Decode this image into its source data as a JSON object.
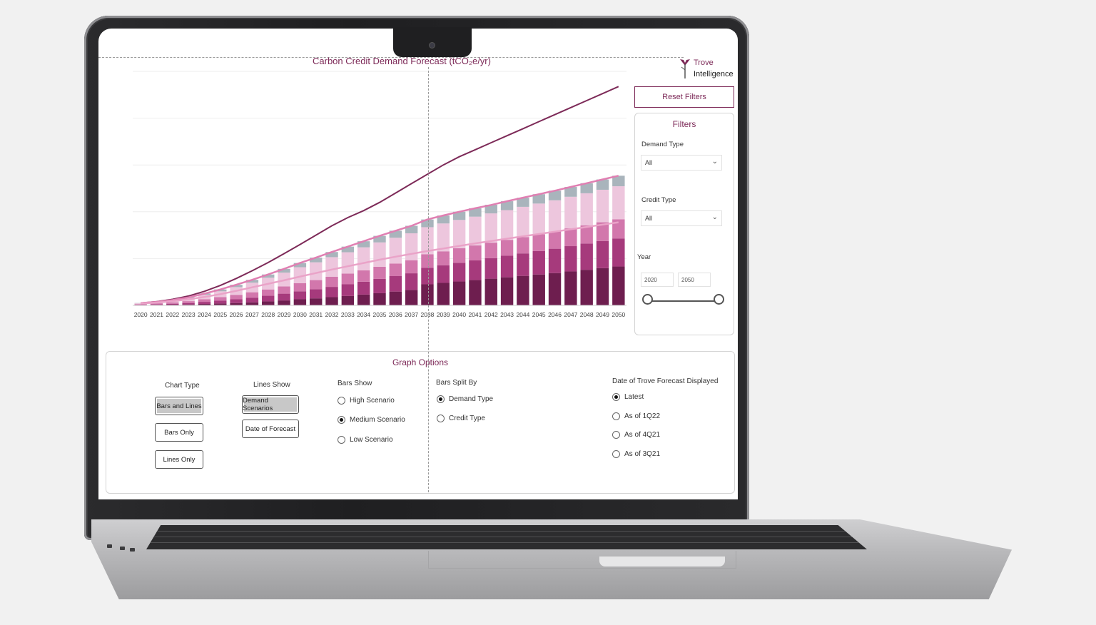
{
  "dashboard": {
    "title": "Carbon Credit Demand Forecast (tCO₂e/yr)",
    "logo": {
      "line1": "Trove",
      "line2": "Intelligence"
    },
    "reset_label": "Reset Filters"
  },
  "filters": {
    "title": "Filters",
    "demand_type": {
      "label": "Demand Type",
      "value": "All"
    },
    "credit_type": {
      "label": "Credit Type",
      "value": "All"
    },
    "year": {
      "label": "Year",
      "from": "2020",
      "to": "2050"
    }
  },
  "graph_options": {
    "title": "Graph Options",
    "chart_type": {
      "label": "Chart Type",
      "options": [
        "Bars and Lines",
        "Bars Only",
        "Lines Only"
      ],
      "selected": "Bars and Lines"
    },
    "lines_show": {
      "label": "Lines Show",
      "options": [
        "Demand Scenarios",
        "Date of Forecast"
      ],
      "selected": "Demand Scenarios"
    },
    "bars_show": {
      "label": "Bars Show",
      "options": [
        "High Scenario",
        "Medium Scenario",
        "Low Scenario"
      ],
      "selected": "Medium Scenario"
    },
    "bars_split_by": {
      "label": "Bars Split By",
      "options": [
        "Demand Type",
        "Credit Type"
      ],
      "selected": "Demand Type"
    },
    "forecast_date": {
      "label": "Date of Trove Forecast Displayed",
      "options": [
        "Latest",
        "As of 1Q22",
        "As of 4Q21",
        "As of 3Q21"
      ],
      "selected": "Latest"
    }
  },
  "colors": {
    "accent": "#7d2a58",
    "seg1": "#6e1e4f",
    "seg2": "#a63a7c",
    "seg3": "#d277ac",
    "seg4": "#edc6dd",
    "seg5": "#a9b4bc",
    "line_high": "#7d2a58",
    "line_mid": "#e07fb2",
    "line_low": "#eaa3c8"
  },
  "chart_data": {
    "type": "bar",
    "stacked": true,
    "categories": [
      "2020",
      "2021",
      "2022",
      "2023",
      "2024",
      "2025",
      "2026",
      "2027",
      "2028",
      "2029",
      "2030",
      "2031",
      "2032",
      "2033",
      "2034",
      "2035",
      "2036",
      "2037",
      "2038",
      "2039",
      "2040",
      "2041",
      "2042",
      "2043",
      "2044",
      "2045",
      "2046",
      "2047",
      "2048",
      "2049",
      "2050"
    ],
    "series": [
      {
        "values": [
          0.1,
          0.2,
          0.3,
          0.4,
          0.6,
          0.8,
          1,
          1.3,
          1.7,
          2.1,
          2.6,
          3,
          3.5,
          4,
          4.6,
          5.2,
          5.9,
          6.6,
          9,
          9.6,
          10.2,
          10.8,
          11.4,
          12,
          12.6,
          13.2,
          13.8,
          14.5,
          15.2,
          15.9,
          16.6
        ]
      },
      {
        "values": [
          0.2,
          0.3,
          0.4,
          0.6,
          0.9,
          1.2,
          1.6,
          2,
          2.4,
          2.9,
          3.4,
          3.9,
          4.4,
          5,
          5.5,
          6.1,
          6.6,
          7.1,
          7,
          7.5,
          8,
          8.4,
          8.8,
          9.2,
          9.6,
          10,
          10.4,
          10.8,
          11.2,
          11.6,
          12
        ]
      },
      {
        "values": [
          0.2,
          0.4,
          0.6,
          0.8,
          1.1,
          1.5,
          1.9,
          2.3,
          2.7,
          3.1,
          3.5,
          3.9,
          4.3,
          4.6,
          4.9,
          5.2,
          5.4,
          5.6,
          5.8,
          6,
          6.2,
          6.4,
          6.6,
          6.8,
          7,
          7.2,
          7.4,
          7.6,
          7.8,
          8,
          8.2
        ]
      },
      {
        "values": [
          0.4,
          0.6,
          0.9,
          1.3,
          1.9,
          2.5,
          3.3,
          4.1,
          5,
          5.9,
          6.8,
          7.6,
          8.4,
          9.1,
          9.8,
          10.4,
          11,
          11.5,
          11.6,
          11.9,
          12.1,
          12.3,
          12.5,
          12.7,
          12.9,
          13.1,
          13.3,
          13.5,
          13.7,
          13.9,
          14.1
        ]
      },
      {
        "values": [
          0.1,
          0.2,
          0.3,
          0.4,
          0.6,
          0.8,
          1,
          1.2,
          1.4,
          1.6,
          1.8,
          2,
          2.2,
          2.4,
          2.6,
          2.8,
          3,
          3.2,
          3.3,
          3.4,
          3.5,
          3.6,
          3.7,
          3.8,
          3.9,
          4,
          4.1,
          4.2,
          4.3,
          4.4,
          4.5
        ]
      }
    ],
    "lines": [
      {
        "values": [
          1,
          1.6,
          2.6,
          4,
          6,
          8.5,
          11.5,
          14.8,
          18.3,
          22.1,
          26,
          30,
          34,
          37.5,
          40.5,
          44,
          48,
          52,
          56,
          60,
          63.5,
          66.5,
          69.5,
          72.5,
          75.5,
          78.5,
          81.5,
          84.5,
          87.5,
          90.5,
          93.5
        ]
      },
      {
        "values": [
          1,
          1.5,
          2.3,
          3.4,
          5,
          6.8,
          8.8,
          10.9,
          13.2,
          15.6,
          18.1,
          20.4,
          22.8,
          25.1,
          27.4,
          29.7,
          31.9,
          34,
          36.7,
          38.4,
          40,
          41.5,
          42.9,
          44.5,
          46,
          47.5,
          49,
          50.6,
          52.2,
          53.8,
          55.4
        ]
      },
      {
        "values": [
          0.8,
          1.2,
          1.8,
          2.6,
          3.6,
          4.8,
          6.2,
          7.7,
          9.2,
          10.7,
          12.3,
          13.8,
          15.3,
          16.7,
          18.1,
          19.5,
          20.8,
          22,
          23.2,
          24.3,
          25.4,
          26.5,
          27.5,
          28.5,
          29.5,
          30.5,
          31.5,
          32.5,
          33.5,
          34.5,
          35.5
        ]
      }
    ],
    "grid": true
  }
}
